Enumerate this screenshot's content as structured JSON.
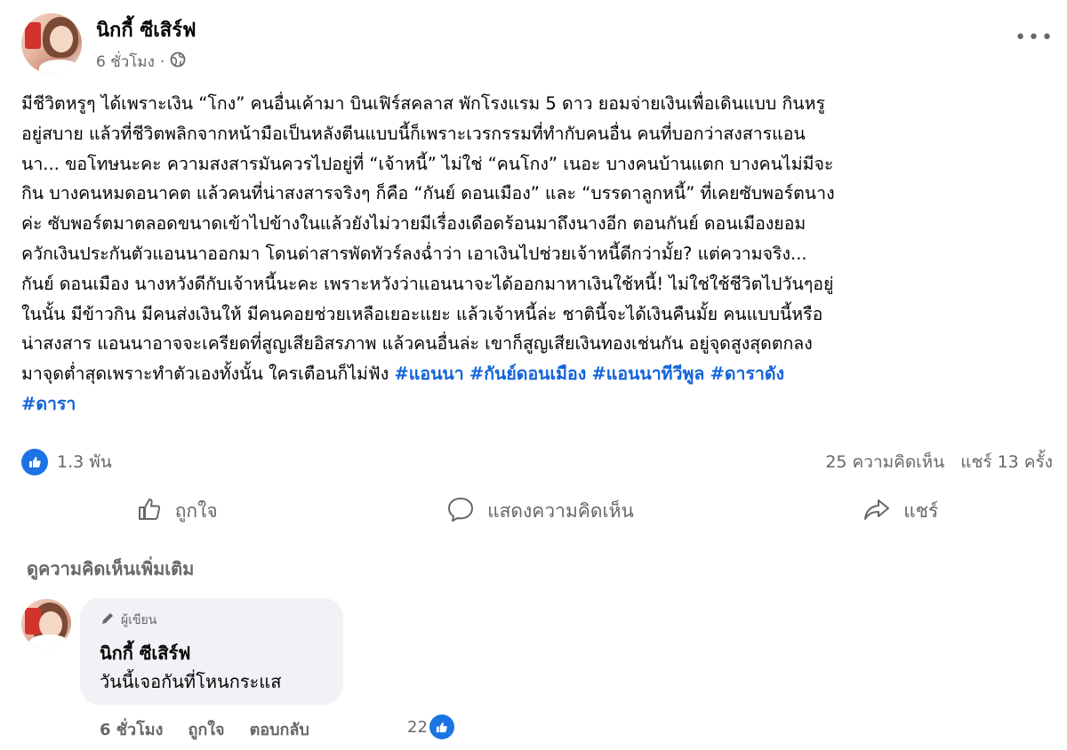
{
  "post": {
    "author": "นิกกี้ ซีเสิร์ฟ",
    "time": "6 ชั่วโมง",
    "separator": "·",
    "privacy_icon": "globe-icon",
    "body_text": "มีชีวิตหรูๆ ได้เพราะเงิน “โกง” คนอื่นเค้ามา บินเฟิร์สคลาส พักโรงแรม 5 ดาว ยอมจ่ายเงินเพื่อเดินแบบ กินหรู\nอยู่สบาย แล้วที่ชีวิตพลิกจากหน้ามือเป็นหลังตีนแบบนี้ก็เพราะเวรกรรมที่ทำกับคนอื่น คนที่บอกว่าสงสารแอน\nนา... ขอโทษนะคะ ความสงสารมันควรไปอยู่ที่ “เจ้าหนี้” ไม่ใช่ “คนโกง” เนอะ บางคนบ้านแตก บางคนไม่มีจะ\nกิน บางคนหมดอนาคต แล้วคนที่น่าสงสารจริงๆ ก็คือ “กันย์ ดอนเมือง” และ “บรรดาลูกหนี้” ที่เคยซับพอร์ตนาง\nค่ะ ซับพอร์ตมาตลอดขนาดเข้าไปข้างในแล้วยังไม่วายมีเรื่องเดือดร้อนมาถึงนางอีก ตอนกันย์ ดอนเมืองยอม\nควักเงินประกันตัวแอนนาออกมา โดนด่าสารพัดทัวร์ลงฉ่ำว่า เอาเงินไปช่วยเจ้าหนี้ดีกว่ามั้ย? แต่ความจริง...\nกันย์ ดอนเมือง นางหวังดีกับเจ้าหนี้นะคะ เพราะหวังว่าแอนนาจะได้ออกมาหาเงินใช้หนี้! ไม่ใช่ใช้ชีวิตไปวันๆอยู่\nในนั้น มีข้าวกิน มีคนส่งเงินให้ มีคนคอยช่วยเหลือเยอะแยะ แล้วเจ้าหนี้ล่ะ ชาตินี้จะได้เงินคืนมั้ย คนแบบนี้หรือ\nน่าสงสาร แอนนาอาจจะเครียดที่สูญเสียอิสรภาพ แล้วคนอื่นล่ะ เขาก็สูญเสียเงินทองเช่นกัน อยู่จุดสูงสุดตกลง\nมาจุดต่ำสุดเพราะทำตัวเองทั้งนั้น ใครเตือนก็ไม่ฟัง",
    "hashtags": [
      "#แอนนา",
      "#กันย์ดอนเมือง",
      "#แอนนาทีวีพูล",
      "#ดาราดัง",
      "#ดารา"
    ],
    "reaction_count": "1.3 พัน",
    "comments_count": "25 ความคิดเห็น",
    "shares_count": "แชร์ 13 ครั้ง"
  },
  "actions": {
    "like": "ถูกใจ",
    "comment": "แสดงความคิดเห็น",
    "share": "แชร์"
  },
  "view_more_comments": "ดูความคิดเห็นเพิ่มเติม",
  "comment": {
    "author_tag": "ผู้เขียน",
    "author": "นิกกี้ ซีเสิร์ฟ",
    "text": "วันนี้เจอกันที่โหนกระแส",
    "time": "6 ชั่วโมง",
    "like": "ถูกใจ",
    "reply": "ตอบกลับ",
    "reaction_count": "22"
  },
  "colors": {
    "accent": "#1b74e4",
    "hashtag": "#1263d9",
    "muted_text": "#65676b",
    "bubble": "#f0f2f5"
  }
}
